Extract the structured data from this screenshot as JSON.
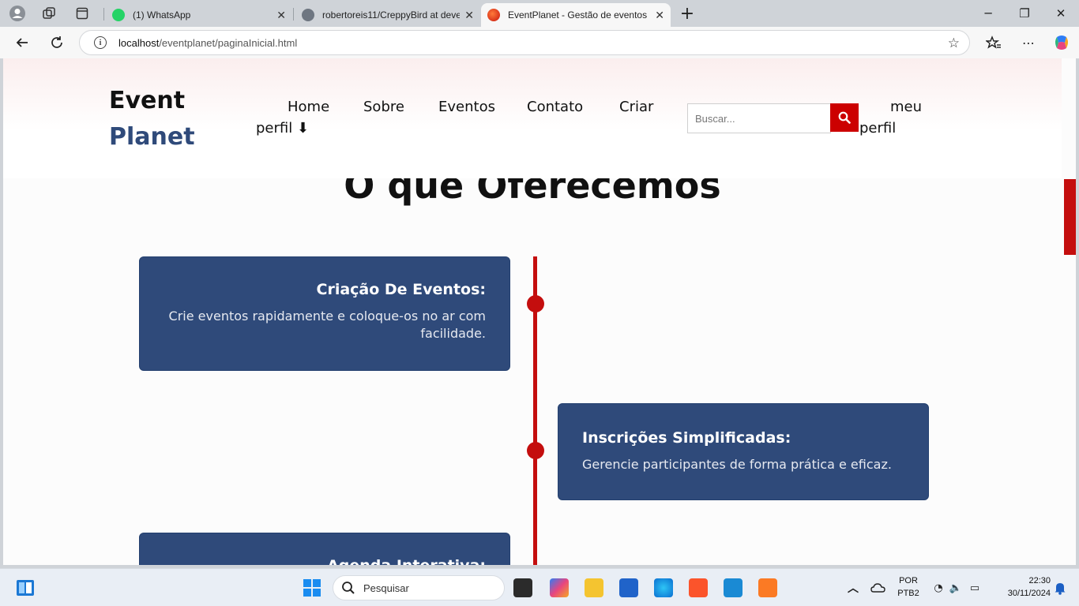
{
  "browser": {
    "tabs": [
      {
        "title": "(1) WhatsApp",
        "favicon": "whatsapp-icon",
        "active": false
      },
      {
        "title": "robertoreis11/CreppyBird at deve",
        "favicon": "github-icon",
        "active": false
      },
      {
        "title": "EventPlanet - Gestão de eventos",
        "favicon": "eventplanet-icon",
        "active": true
      }
    ],
    "new_tab_label": "+",
    "url_host": "localhost",
    "url_path": "/eventplanet/paginaInicial.html"
  },
  "site": {
    "logo_line1": "Event",
    "logo_line2": "Planet",
    "nav": {
      "home": "Home",
      "about": "Sobre",
      "events": "Eventos",
      "contact": "Contato",
      "create": "Criar",
      "profile_prefix": "perfil ⬇",
      "profile_meu": "meu",
      "profile_perfil": "perfil"
    },
    "search_placeholder": "Buscar...",
    "section_title": "O que Oferecemos",
    "features": [
      {
        "title": "Criação De Eventos:",
        "description": "Crie eventos rapidamente e coloque-os no ar com facilidade."
      },
      {
        "title": "Inscrições Simplificadas:",
        "description": "Gerencie participantes de forma prática e eficaz."
      },
      {
        "title": "Agenda Interativa:",
        "description": ""
      }
    ],
    "colors": {
      "primary": "#2f4a7a",
      "accent": "#c40e0e"
    }
  },
  "taskbar": {
    "search_label": "Pesquisar",
    "lang_line1": "POR",
    "lang_line2": "PTB2",
    "time": "22:30",
    "date": "30/11/2024"
  }
}
